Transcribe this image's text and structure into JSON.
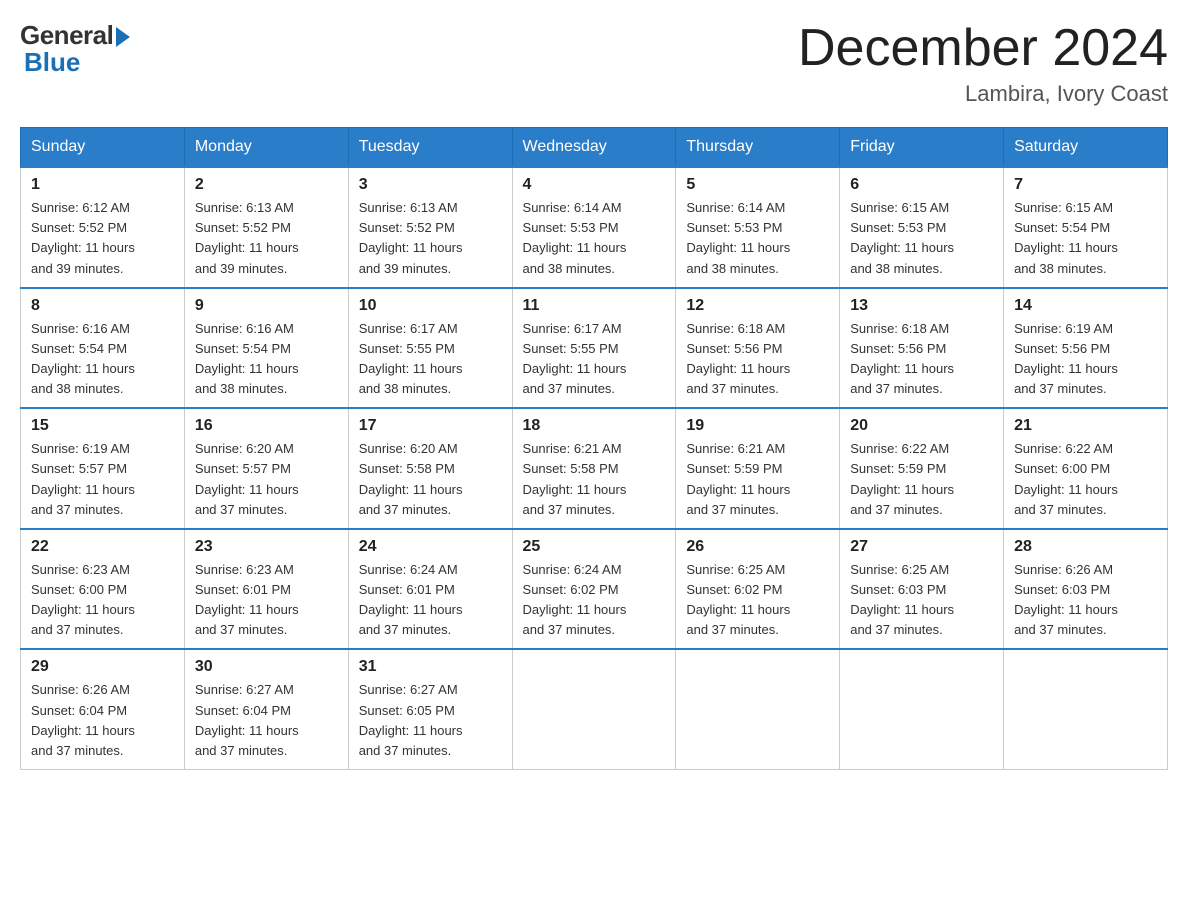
{
  "header": {
    "logo_general": "General",
    "logo_blue": "Blue",
    "month_title": "December 2024",
    "location": "Lambira, Ivory Coast"
  },
  "days_of_week": [
    "Sunday",
    "Monday",
    "Tuesday",
    "Wednesday",
    "Thursday",
    "Friday",
    "Saturday"
  ],
  "weeks": [
    [
      {
        "day": "1",
        "sunrise": "6:12 AM",
        "sunset": "5:52 PM",
        "daylight": "11 hours and 39 minutes."
      },
      {
        "day": "2",
        "sunrise": "6:13 AM",
        "sunset": "5:52 PM",
        "daylight": "11 hours and 39 minutes."
      },
      {
        "day": "3",
        "sunrise": "6:13 AM",
        "sunset": "5:52 PM",
        "daylight": "11 hours and 39 minutes."
      },
      {
        "day": "4",
        "sunrise": "6:14 AM",
        "sunset": "5:53 PM",
        "daylight": "11 hours and 38 minutes."
      },
      {
        "day": "5",
        "sunrise": "6:14 AM",
        "sunset": "5:53 PM",
        "daylight": "11 hours and 38 minutes."
      },
      {
        "day": "6",
        "sunrise": "6:15 AM",
        "sunset": "5:53 PM",
        "daylight": "11 hours and 38 minutes."
      },
      {
        "day": "7",
        "sunrise": "6:15 AM",
        "sunset": "5:54 PM",
        "daylight": "11 hours and 38 minutes."
      }
    ],
    [
      {
        "day": "8",
        "sunrise": "6:16 AM",
        "sunset": "5:54 PM",
        "daylight": "11 hours and 38 minutes."
      },
      {
        "day": "9",
        "sunrise": "6:16 AM",
        "sunset": "5:54 PM",
        "daylight": "11 hours and 38 minutes."
      },
      {
        "day": "10",
        "sunrise": "6:17 AM",
        "sunset": "5:55 PM",
        "daylight": "11 hours and 38 minutes."
      },
      {
        "day": "11",
        "sunrise": "6:17 AM",
        "sunset": "5:55 PM",
        "daylight": "11 hours and 37 minutes."
      },
      {
        "day": "12",
        "sunrise": "6:18 AM",
        "sunset": "5:56 PM",
        "daylight": "11 hours and 37 minutes."
      },
      {
        "day": "13",
        "sunrise": "6:18 AM",
        "sunset": "5:56 PM",
        "daylight": "11 hours and 37 minutes."
      },
      {
        "day": "14",
        "sunrise": "6:19 AM",
        "sunset": "5:56 PM",
        "daylight": "11 hours and 37 minutes."
      }
    ],
    [
      {
        "day": "15",
        "sunrise": "6:19 AM",
        "sunset": "5:57 PM",
        "daylight": "11 hours and 37 minutes."
      },
      {
        "day": "16",
        "sunrise": "6:20 AM",
        "sunset": "5:57 PM",
        "daylight": "11 hours and 37 minutes."
      },
      {
        "day": "17",
        "sunrise": "6:20 AM",
        "sunset": "5:58 PM",
        "daylight": "11 hours and 37 minutes."
      },
      {
        "day": "18",
        "sunrise": "6:21 AM",
        "sunset": "5:58 PM",
        "daylight": "11 hours and 37 minutes."
      },
      {
        "day": "19",
        "sunrise": "6:21 AM",
        "sunset": "5:59 PM",
        "daylight": "11 hours and 37 minutes."
      },
      {
        "day": "20",
        "sunrise": "6:22 AM",
        "sunset": "5:59 PM",
        "daylight": "11 hours and 37 minutes."
      },
      {
        "day": "21",
        "sunrise": "6:22 AM",
        "sunset": "6:00 PM",
        "daylight": "11 hours and 37 minutes."
      }
    ],
    [
      {
        "day": "22",
        "sunrise": "6:23 AM",
        "sunset": "6:00 PM",
        "daylight": "11 hours and 37 minutes."
      },
      {
        "day": "23",
        "sunrise": "6:23 AM",
        "sunset": "6:01 PM",
        "daylight": "11 hours and 37 minutes."
      },
      {
        "day": "24",
        "sunrise": "6:24 AM",
        "sunset": "6:01 PM",
        "daylight": "11 hours and 37 minutes."
      },
      {
        "day": "25",
        "sunrise": "6:24 AM",
        "sunset": "6:02 PM",
        "daylight": "11 hours and 37 minutes."
      },
      {
        "day": "26",
        "sunrise": "6:25 AM",
        "sunset": "6:02 PM",
        "daylight": "11 hours and 37 minutes."
      },
      {
        "day": "27",
        "sunrise": "6:25 AM",
        "sunset": "6:03 PM",
        "daylight": "11 hours and 37 minutes."
      },
      {
        "day": "28",
        "sunrise": "6:26 AM",
        "sunset": "6:03 PM",
        "daylight": "11 hours and 37 minutes."
      }
    ],
    [
      {
        "day": "29",
        "sunrise": "6:26 AM",
        "sunset": "6:04 PM",
        "daylight": "11 hours and 37 minutes."
      },
      {
        "day": "30",
        "sunrise": "6:27 AM",
        "sunset": "6:04 PM",
        "daylight": "11 hours and 37 minutes."
      },
      {
        "day": "31",
        "sunrise": "6:27 AM",
        "sunset": "6:05 PM",
        "daylight": "11 hours and 37 minutes."
      },
      null,
      null,
      null,
      null
    ]
  ],
  "labels": {
    "sunrise": "Sunrise:",
    "sunset": "Sunset:",
    "daylight": "Daylight:"
  }
}
